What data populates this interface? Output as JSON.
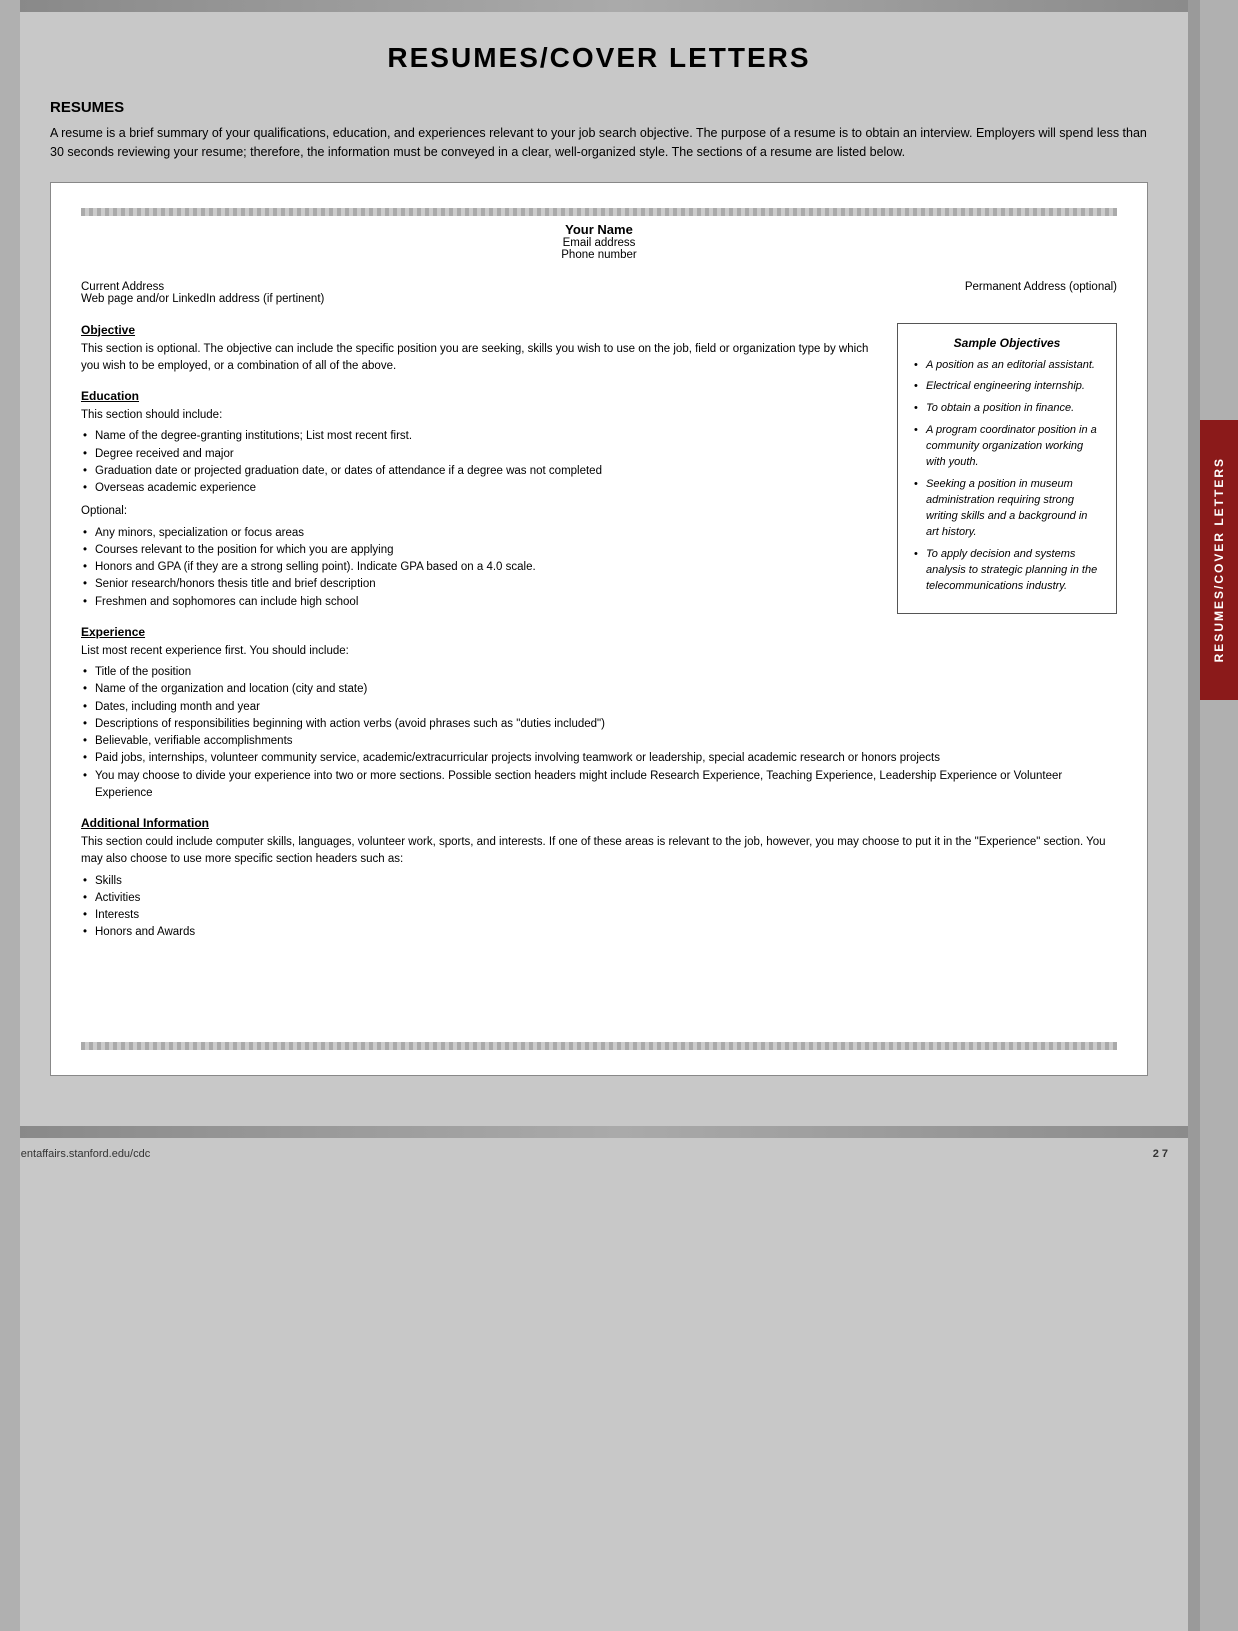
{
  "page": {
    "title": "RESUMES/COVER LETTERS",
    "footer_url": "studentaffairs.stanford.edu/cdc",
    "footer_page": "2 7"
  },
  "side_tab": {
    "label": "RESUMES/COVER LETTERS"
  },
  "resumes_section": {
    "heading": "RESUMES",
    "intro": "A resume is a brief summary of your qualifications, education, and experiences relevant to your job search objective. The purpose of a resume is to obtain an interview. Employers will spend less than 30 seconds reviewing your resume; therefore, the information must be conveyed in a clear, well-organized style. The sections of a resume are listed below."
  },
  "resume_template": {
    "name": "Your Name",
    "email": "Email address",
    "phone": "Phone number",
    "current_address": "Current Address",
    "web_address": "Web page and/or LinkedIn address (if pertinent)",
    "permanent_address": "Permanent Address (optional)"
  },
  "sections": {
    "objective": {
      "title": "Objective",
      "text": "This section is optional. The objective can include the specific position you are seeking, skills you wish to use on the job, field or organization type by which you wish to be employed, or a combination of all of the above."
    },
    "education": {
      "title": "Education",
      "intro": "This section should include:",
      "bullets": [
        "Name of the degree-granting institutions; List most recent first.",
        "Degree received and major",
        "Graduation date or projected graduation date, or dates of attendance if a degree was not completed",
        "Overseas academic experience"
      ],
      "optional_label": "Optional:",
      "optional_bullets": [
        "Any minors, specialization or focus areas",
        "Courses relevant to the position for which you are applying",
        "Honors and GPA (if they are a strong selling point). Indicate GPA based on a 4.0 scale.",
        "Senior research/honors thesis title and brief description",
        "Freshmen and sophomores can include high school"
      ]
    },
    "experience": {
      "title": "Experience",
      "intro": "List most recent experience first. You should include:",
      "bullets": [
        "Title of the position",
        "Name of the organization and location (city and state)",
        "Dates, including month and year",
        "Descriptions of responsibilities beginning with action verbs (avoid phrases such as \"duties included\")",
        "Believable, verifiable accomplishments",
        "Paid jobs, internships, volunteer community service, academic/extracurricular projects involving teamwork or leadership, special academic research or honors projects",
        "You may choose to divide your experience into two or more sections. Possible section headers might include Research Experience, Teaching Experience, Leadership Experience or Volunteer Experience"
      ]
    },
    "additional_information": {
      "title": "Additional Information",
      "text": "This section could include computer skills, languages, volunteer work, sports, and interests. If one of these areas is relevant to the job, however, you may choose to put it in the \"Experience\" section. You may also choose to use more specific section headers such as:",
      "bullets": [
        "Skills",
        "Activities",
        "Interests",
        "Honors and Awards"
      ]
    }
  },
  "sample_objectives": {
    "title": "Sample Objectives",
    "items": [
      "A position as an editorial assistant.",
      "Electrical engineering internship.",
      "To obtain a position in finance.",
      "A program coordinator position in a community organization working with youth.",
      "Seeking a position in museum administration requiring strong writing skills and a background in art history.",
      "To apply decision and systems analysis to strategic planning in the telecommunications industry."
    ]
  }
}
